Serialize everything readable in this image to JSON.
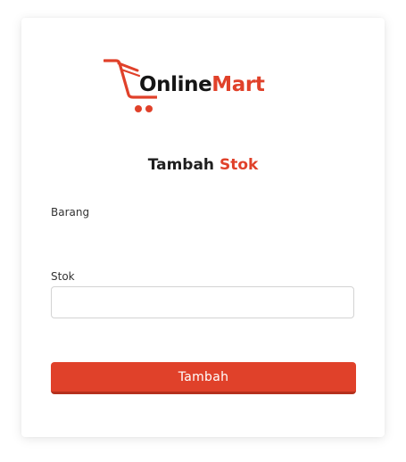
{
  "brand": {
    "name_part1": "Online",
    "name_part2": "Mart",
    "accent_color": "#e0412a",
    "dark_color": "#151515",
    "icon": "shopping-cart-icon"
  },
  "form": {
    "title_part1": "Tambah",
    "title_part2": "Stok",
    "barang_label": "Barang",
    "stok_label": "Stok",
    "stok_value": "",
    "submit_label": "Tambah"
  }
}
